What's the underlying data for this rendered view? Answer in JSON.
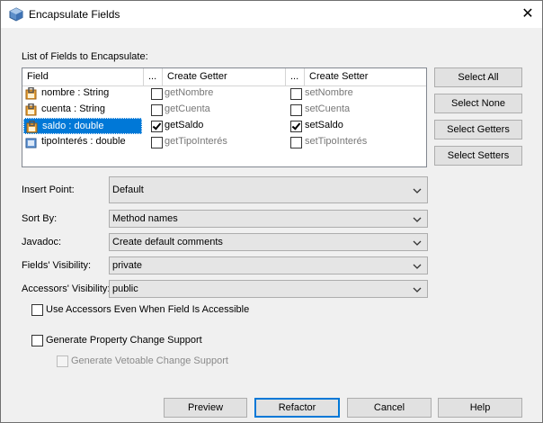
{
  "window": {
    "title": "Encapsulate Fields"
  },
  "fields_label": "List of Fields to Encapsulate:",
  "table": {
    "headers": {
      "field": "Field",
      "dots1": "...",
      "getter": "Create Getter",
      "dots2": "...",
      "setter": "Create Setter"
    },
    "rows": [
      {
        "field": "nombre : String",
        "getter": "getNombre",
        "getter_checked": false,
        "setter": "setNombre",
        "setter_checked": false,
        "selected": false
      },
      {
        "field": "cuenta : String",
        "getter": "getCuenta",
        "getter_checked": false,
        "setter": "setCuenta",
        "setter_checked": false,
        "selected": false
      },
      {
        "field": "saldo : double",
        "getter": "getSaldo",
        "getter_checked": true,
        "setter": "setSaldo",
        "setter_checked": true,
        "selected": true
      },
      {
        "field": "tipoInterés : double",
        "getter": "getTipoInterés",
        "getter_checked": false,
        "setter": "setTipoInterés",
        "setter_checked": false,
        "selected": false
      }
    ]
  },
  "side_buttons": {
    "select_all": "Select All",
    "select_none": "Select None",
    "select_getters": "Select Getters",
    "select_setters": "Select Setters"
  },
  "form": {
    "insert_point": {
      "label": "Insert Point:",
      "value": "Default"
    },
    "sort_by": {
      "label": "Sort By:",
      "value": "Method names"
    },
    "javadoc": {
      "label": "Javadoc:",
      "value": "Create default comments"
    },
    "fields_visibility": {
      "label": "Fields' Visibility:",
      "value": "private"
    },
    "accessors_visibility": {
      "label": "Accessors' Visibility:",
      "value": "public"
    }
  },
  "options": {
    "use_accessors": {
      "label": "Use Accessors Even When Field Is Accessible",
      "checked": false
    },
    "property_change": {
      "label": "Generate Property Change Support",
      "checked": false
    },
    "vetoable_change": {
      "label": "Generate Vetoable Change Support",
      "checked": false,
      "enabled": false
    }
  },
  "footer": {
    "preview": "Preview",
    "refactor": "Refactor",
    "cancel": "Cancel",
    "help": "Help"
  }
}
